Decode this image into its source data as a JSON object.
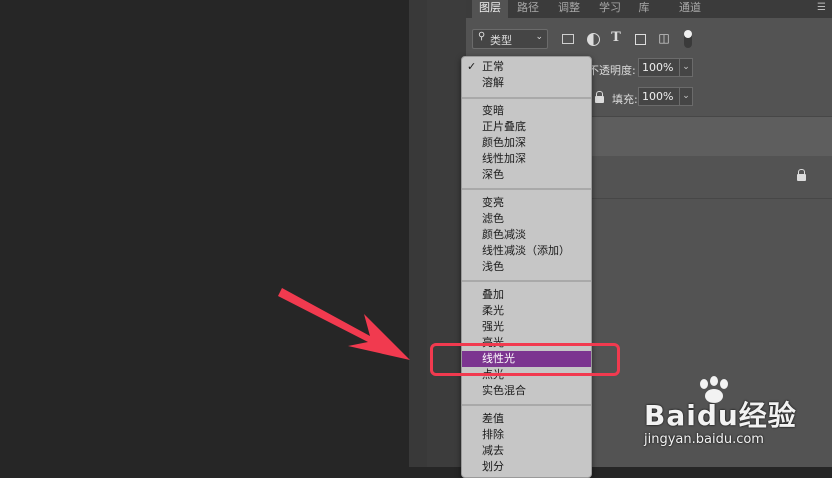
{
  "panel": {
    "tabs": [
      "图层",
      "路径",
      "调整",
      "学习",
      "库",
      "通道"
    ],
    "active_tab": "图层",
    "menu_icon": "hamburger-icon"
  },
  "filter": {
    "kind_label": "类型",
    "icons": [
      "image-filter-icon",
      "adjustment-filter-icon",
      "type-filter-icon",
      "shape-filter-icon",
      "smart-object-filter-icon"
    ]
  },
  "opacity": {
    "label": "不透明度:",
    "value": "100%"
  },
  "fill": {
    "label": "填充:",
    "value": "100%"
  },
  "blend_menu": {
    "groups": [
      [
        "正常",
        "溶解"
      ],
      [
        "变暗",
        "正片叠底",
        "颜色加深",
        "线性加深",
        "深色"
      ],
      [
        "变亮",
        "滤色",
        "颜色减淡",
        "线性减淡（添加）",
        "浅色"
      ],
      [
        "叠加",
        "柔光",
        "强光",
        "亮光",
        "线性光",
        "点光",
        "实色混合"
      ],
      [
        "差值",
        "排除",
        "减去",
        "划分"
      ]
    ],
    "checked": "正常",
    "highlighted": "线性光"
  },
  "watermark": {
    "brand": "Baidu经验",
    "url": "jingyan.baidu.com"
  },
  "colors": {
    "highlight": "#7c3590",
    "annotation": "#f13a4f"
  }
}
